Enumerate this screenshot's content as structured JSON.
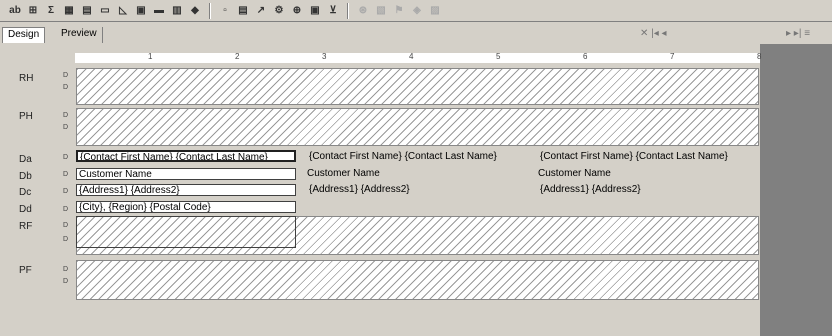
{
  "toolbar": {
    "buttons": [
      "ab",
      "⊞",
      "Σ",
      "▦",
      "▤",
      "▭",
      "◺",
      "▣",
      "▬",
      "▥",
      "◆",
      "▫",
      "▤",
      "↗",
      "⚙",
      "⊕",
      "▣",
      "⊻",
      "⊛",
      "▧",
      "⚑",
      "◈",
      "▨"
    ]
  },
  "tabs": {
    "design": "Design",
    "preview": "Preview"
  },
  "nav_mid": "✕ |◂ ◂",
  "nav_right": "▸ ▸| ≡",
  "ruler": {
    "marks": [
      "1",
      "2",
      "3",
      "4",
      "5",
      "6",
      "7",
      "8"
    ]
  },
  "bands": {
    "rh": "RH",
    "ph": "PH",
    "da": "Da",
    "db": "Db",
    "dc": "Dc",
    "dd": "Dd",
    "rf": "RF",
    "pf": "PF"
  },
  "fields": {
    "name1": "{Contact First Name} {Contact Last Name}",
    "name2": "{Contact First Name} {Contact Last Name}",
    "name3": "{Contact First Name} {Contact Last Name}",
    "cust1": "Customer Name",
    "cust2": "Customer Name",
    "cust3": "Customer Name",
    "addr1": "{Address1} {Address2}",
    "addr2": "{Address1} {Address2}",
    "addr3": "{Address1} {Address2}",
    "city": "{City}, {Region} {Postal Code}"
  }
}
